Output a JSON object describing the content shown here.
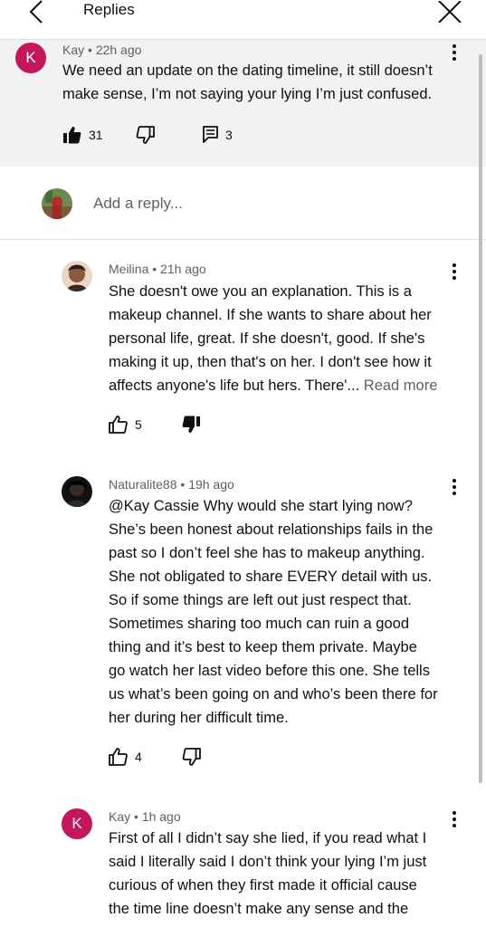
{
  "header": {
    "title": "Replies"
  },
  "parent_comment": {
    "avatar_letter": "K",
    "author": "Kay",
    "time": "22h ago",
    "text_lines": [
      "We need an update on the dating timeline, it still doesn’t",
      "make sense, I’m not saying your lying I’m just confused."
    ],
    "likes": "31",
    "replies": "3"
  },
  "reply_box": {
    "placeholder": "Add a reply..."
  },
  "replies": [
    {
      "author": "Meilina",
      "time": "21h ago",
      "text_lines": [
        "She doesn't owe you an explanation. This is a",
        "makeup channel. If she wants to share about her",
        "personal life, great. If she doesn't, good. If she's",
        "making it up, then that's on her. I don't see how it",
        "affects anyone's life but hers. There'..."
      ],
      "read_more": "Read more",
      "likes": "5"
    },
    {
      "author": "Naturalite88",
      "time": "19h ago",
      "text_lines": [
        "@Kay Cassie Why would she start lying now?",
        "She’s been honest about relationships fails in the",
        "past so I don’t feel she has to makeup anything.",
        "She not obligated to share EVERY detail with us.",
        "So if some things are left out just respect that.",
        "Sometimes sharing too much can ruin a good",
        "thing and it’s best to keep them private. Maybe",
        "go watch her last video before this one. She tells",
        "us what’s been going on and who’s been there for",
        "her during her difficult time."
      ],
      "likes": "4"
    },
    {
      "avatar_letter": "K",
      "author": "Kay",
      "time": "1h ago",
      "text_lines": [
        "First of all I didn’t say she lied, if you read what I",
        "said I literally said I don’t think your lying I’m just",
        "curious of when they first made it official cause",
        "the time line doesn’t make any sense and the"
      ]
    }
  ],
  "icons": {
    "back": "chevron-left-icon",
    "close": "close-icon",
    "like": "thumbs-up-icon",
    "dislike": "thumbs-down-icon",
    "reply": "comment-icon",
    "more": "kebab-menu-icon"
  },
  "colors": {
    "avatar_k": "#c2185b",
    "parent_bg": "#f2f2f2",
    "meta_text": "#606060"
  }
}
